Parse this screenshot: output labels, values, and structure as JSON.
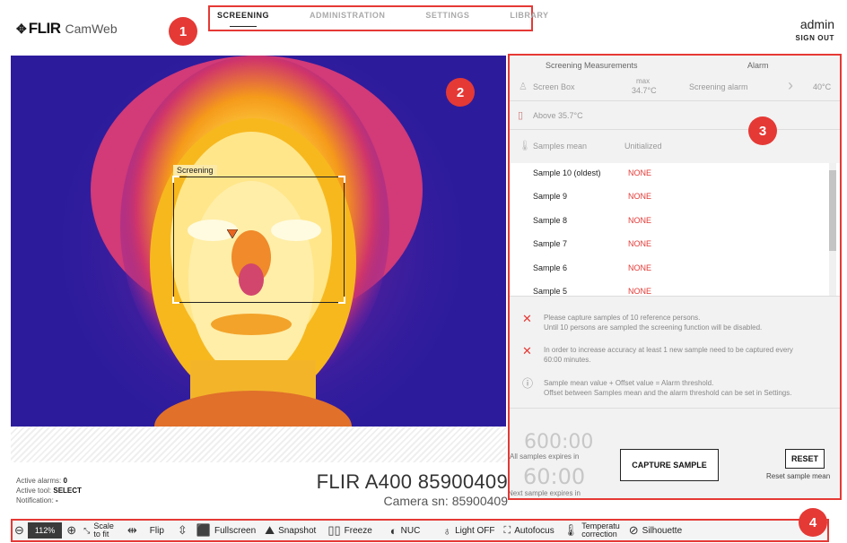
{
  "header": {
    "brand": "FLIR",
    "app": "CamWeb",
    "tabs": [
      {
        "label": "SCREENING",
        "active": true
      },
      {
        "label": "ADMINISTRATION"
      },
      {
        "label": "SETTINGS"
      },
      {
        "label": "LIBRARY"
      }
    ],
    "user": "admin",
    "sign_out": "SIGN OUT"
  },
  "badges": [
    "1",
    "2",
    "3",
    "4"
  ],
  "video": {
    "roi_label": "Screening"
  },
  "status": {
    "alarms_label": "Active alarms:",
    "alarms_value": "0",
    "tool_label": "Active tool:",
    "tool_value": "SELECT",
    "notif_label": "Notification:",
    "notif_value": "-"
  },
  "camera": {
    "name": "FLIR A400 85900409",
    "sn": "Camera sn: 85900409"
  },
  "panel": {
    "col1": "Screening Measurements",
    "col2": "Alarm",
    "screen_box": "Screen Box",
    "max_label": "max",
    "max_value": "34.7°C",
    "screening_alarm": "Screening alarm",
    "alarm_value": "40°C",
    "above": "Above 35.7°C",
    "samples_mean": "Samples mean",
    "samples_mean_value": "Unitialized",
    "samples": [
      {
        "label": "Sample 10 (oldest)",
        "value": "NONE"
      },
      {
        "label": "Sample 9",
        "value": "NONE"
      },
      {
        "label": "Sample 8",
        "value": "NONE"
      },
      {
        "label": "Sample 7",
        "value": "NONE"
      },
      {
        "label": "Sample 6",
        "value": "NONE"
      },
      {
        "label": "Sample 5",
        "value": "NONE"
      }
    ],
    "notes": [
      {
        "line1": "Please capture samples of 10 reference persons.",
        "line2": "Until 10 persons are sampled the screening function will be disabled."
      },
      {
        "line1": "In order to increase accuracy at least 1 new sample need to be captured every",
        "line2": "60:00 minutes."
      },
      {
        "line1": "Sample mean value + Offset value = Alarm threshold.",
        "line2": "Offset between Samples mean and the alarm threshold can be set in Settings."
      }
    ],
    "timer1": "600:00",
    "timer1_label": "All samples expires in",
    "timer2": "60:00",
    "timer2_label": "Next sample expires in",
    "capture": "CAPTURE SAMPLE",
    "reset": "RESET",
    "reset_label": "Reset sample mean"
  },
  "toolbar": {
    "zoom": "112%",
    "scale1": "Scale",
    "scale2": "to fit",
    "flip": "Flip",
    "fullscreen": "Fullscreen",
    "snapshot": "Snapshot",
    "freeze": "Freeze",
    "nuc": "NUC",
    "light": "Light OFF",
    "autofocus": "Autofocus",
    "temp1": "Temperatu",
    "temp2": "correction",
    "silhouette": "Silhouette"
  },
  "colors": {
    "accent": "#e53935",
    "none": "#e53935"
  }
}
